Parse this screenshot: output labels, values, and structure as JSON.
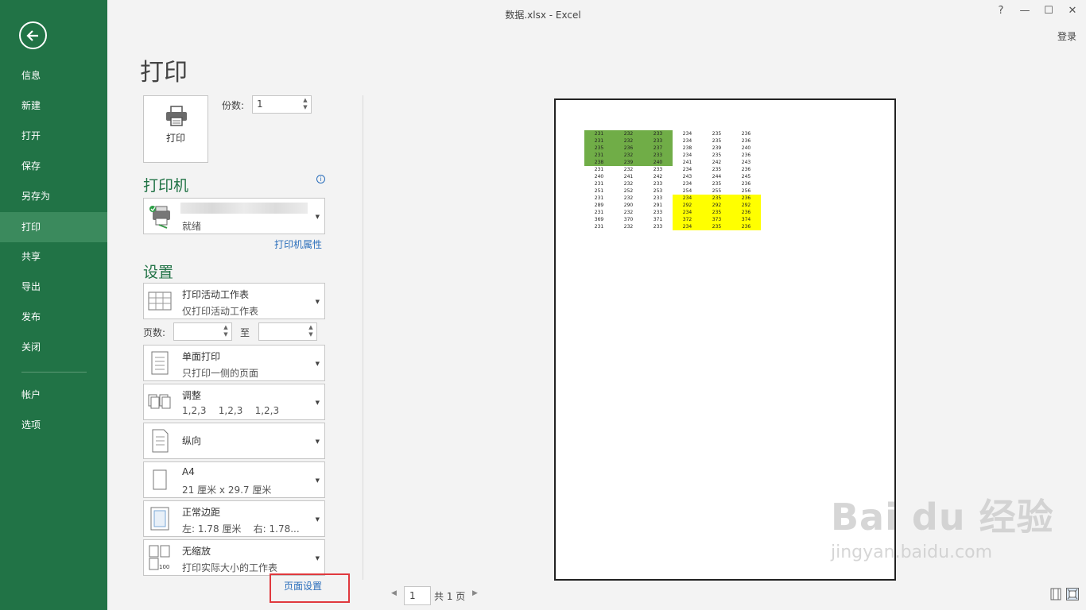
{
  "window": {
    "title": "数据.xlsx - Excel",
    "help": "?",
    "minimize": "—",
    "maximize": "☐",
    "close": "✕",
    "login": "登录"
  },
  "sidebar": {
    "items": [
      {
        "label": "信息"
      },
      {
        "label": "新建"
      },
      {
        "label": "打开"
      },
      {
        "label": "保存"
      },
      {
        "label": "另存为"
      },
      {
        "label": "打印"
      },
      {
        "label": "共享"
      },
      {
        "label": "导出"
      },
      {
        "label": "发布"
      },
      {
        "label": "关闭"
      },
      {
        "label": "帐户"
      },
      {
        "label": "选项"
      }
    ],
    "active": "打印"
  },
  "print": {
    "title": "打印",
    "print_button": "打印",
    "copies_label": "份数:",
    "copies_value": "1"
  },
  "printer": {
    "heading": "打印机",
    "status": "就绪",
    "properties_link": "打印机属性"
  },
  "settings": {
    "heading": "设置",
    "scope": {
      "title": "打印活动工作表",
      "sub": "仅打印活动工作表"
    },
    "pages_label": "页数:",
    "to_label": "至",
    "sides": {
      "title": "单面打印",
      "sub": "只打印一侧的页面"
    },
    "collate": {
      "title": "调整",
      "sub": "1,2,3    1,2,3    1,2,3"
    },
    "orientation": {
      "title": "纵向"
    },
    "paper": {
      "title": "A4",
      "sub": "21 厘米 x 29.7 厘米"
    },
    "margins": {
      "title": "正常边距",
      "sub": "左: 1.78 厘米    右: 1.78..."
    },
    "scaling": {
      "title": "无缩放",
      "sub": "打印实际大小的工作表"
    },
    "page_setup_link": "页面设置"
  },
  "pager": {
    "current": "1",
    "total_text": "共 1 页"
  },
  "preview_table": {
    "rows": [
      [
        "231",
        "232",
        "233",
        "234",
        "235",
        "236"
      ],
      [
        "231",
        "232",
        "233",
        "234",
        "235",
        "236"
      ],
      [
        "235",
        "236",
        "237",
        "238",
        "239",
        "240"
      ],
      [
        "231",
        "232",
        "233",
        "234",
        "235",
        "236"
      ],
      [
        "238",
        "239",
        "240",
        "241",
        "242",
        "243"
      ],
      [
        "231",
        "232",
        "233",
        "234",
        "235",
        "236"
      ],
      [
        "240",
        "241",
        "242",
        "243",
        "244",
        "245"
      ],
      [
        "231",
        "232",
        "233",
        "234",
        "235",
        "236"
      ],
      [
        "251",
        "252",
        "253",
        "254",
        "255",
        "256"
      ],
      [
        "231",
        "232",
        "233",
        "234",
        "235",
        "236"
      ],
      [
        "289",
        "290",
        "291",
        "292",
        "292",
        "292"
      ],
      [
        "231",
        "232",
        "233",
        "234",
        "235",
        "236"
      ],
      [
        "369",
        "370",
        "371",
        "372",
        "373",
        "374"
      ],
      [
        "231",
        "232",
        "233",
        "234",
        "235",
        "236"
      ]
    ],
    "highlight_green_color": "#70ad47",
    "highlight_yellow_color": "#ffff00"
  },
  "watermark": {
    "brand": "Bai du 经验",
    "url": "jingyan.baidu.com"
  },
  "colors": {
    "sidebar": "#217346",
    "sidebar_active": "#3b8a5d",
    "link": "#2a6ebb",
    "highlight_box": "#e0393e"
  }
}
